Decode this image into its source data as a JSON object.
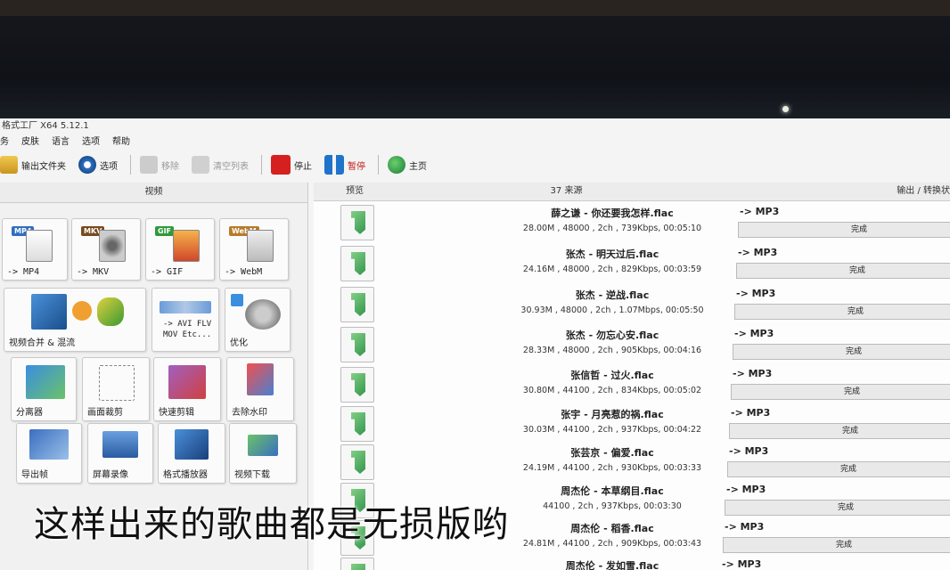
{
  "window": {
    "title": "格式工厂 X64 5.12.1"
  },
  "menu": [
    "务",
    "皮肤",
    "语言",
    "选项",
    "帮助"
  ],
  "toolbar": {
    "output_folder": "输出文件夹",
    "options": "选项",
    "remove": "移除",
    "clear_list": "清空列表",
    "stop": "停止",
    "pause": "暂停",
    "home": "主页"
  },
  "left_panel": {
    "header": "视频",
    "tiles": [
      {
        "badge": "MP4",
        "label": "-> MP4"
      },
      {
        "badge": "MKV",
        "label": "-> MKV"
      },
      {
        "badge": "GIF",
        "label": "-> GIF"
      },
      {
        "badge": "WebM",
        "label": "-> WebM"
      },
      {
        "label": "视频合并 & 混流"
      },
      {
        "label": "-> AVI FLV\nMOV Etc..."
      },
      {
        "label": "优化"
      },
      {
        "label": "分离器"
      },
      {
        "label": "画面裁剪"
      },
      {
        "label": "快速剪辑"
      },
      {
        "label": "去除水印"
      },
      {
        "label": "导出帧"
      },
      {
        "label": "屏幕录像"
      },
      {
        "label": "格式播放器"
      },
      {
        "label": "视频下载"
      }
    ]
  },
  "table": {
    "headers": {
      "preview": "预览",
      "source": "37 来源",
      "output": "输出 / 转换状态"
    },
    "rows": [
      {
        "name": "薛之谦 - 你还要我怎样.flac",
        "info": "28.00M , 48000 , 2ch , 739Kbps, 00:05:10",
        "format": "-> MP3",
        "status": "完成"
      },
      {
        "name": "张杰 - 明天过后.flac",
        "info": "24.16M , 48000 , 2ch , 829Kbps, 00:03:59",
        "format": "-> MP3",
        "status": "完成"
      },
      {
        "name": "张杰 - 逆战.flac",
        "info": "30.93M , 48000 , 2ch , 1.07Mbps, 00:05:50",
        "format": "-> MP3",
        "status": "完成"
      },
      {
        "name": "张杰 - 勿忘心安.flac",
        "info": "28.33M , 48000 , 2ch , 905Kbps, 00:04:16",
        "format": "-> MP3",
        "status": "完成"
      },
      {
        "name": "张信哲 - 过火.flac",
        "info": "30.80M , 44100 , 2ch , 834Kbps, 00:05:02",
        "format": "-> MP3",
        "status": "完成"
      },
      {
        "name": "张宇 - 月亮惹的祸.flac",
        "info": "30.03M , 44100 , 2ch , 937Kbps, 00:04:22",
        "format": "-> MP3",
        "status": "完成"
      },
      {
        "name": "张芸京 - 偏爱.flac",
        "info": "24.19M , 44100 , 2ch , 930Kbps, 00:03:33",
        "format": "-> MP3",
        "status": "完成"
      },
      {
        "name": "周杰伦 - 本草纲目.flac",
        "info": "44100 , 2ch , 937Kbps, 00:03:30",
        "format": "-> MP3",
        "status": "完成"
      },
      {
        "name": "周杰伦 - 稻香.flac",
        "info": "24.81M , 44100 , 2ch , 909Kbps, 00:03:43",
        "format": "-> MP3",
        "status": "完成"
      },
      {
        "name": "周杰伦 - 发如雪.flac",
        "info": "",
        "format": "-> MP3",
        "status": ""
      }
    ]
  },
  "caption": "这样出来的歌曲都是无损版哟",
  "colors": {
    "stop": "#d62020",
    "pause": "#1f73c9",
    "accent_green": "#1d8a3a"
  }
}
